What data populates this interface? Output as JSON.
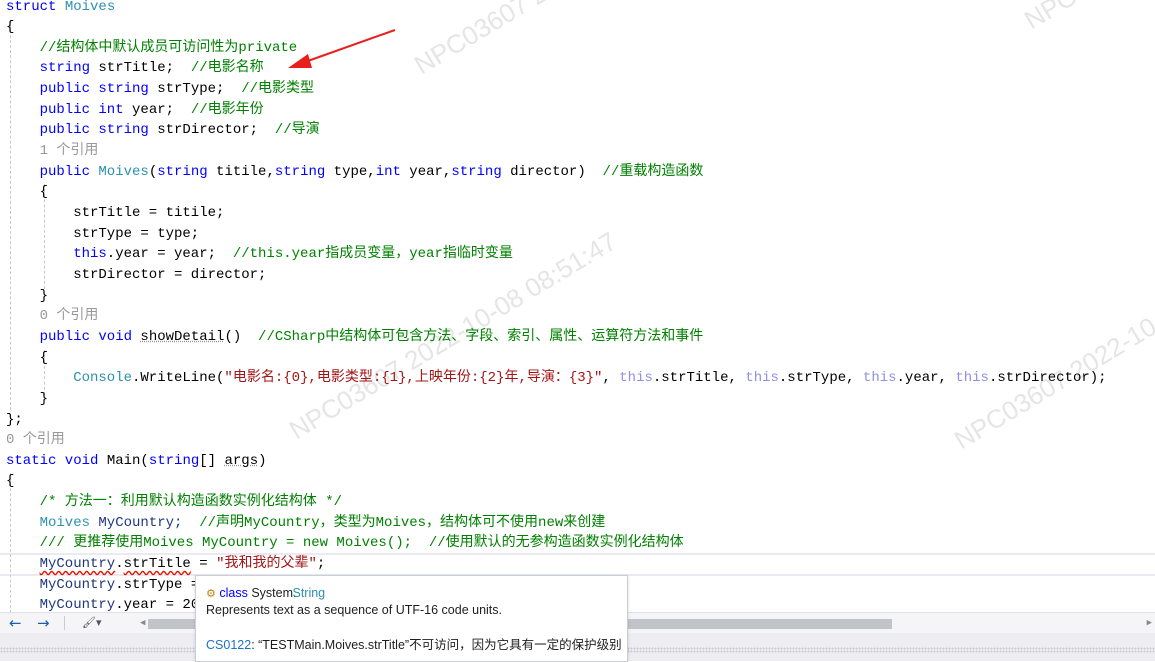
{
  "watermark": "NPC03607 2022-10-08 08:51:47",
  "colors": {
    "keyword": "#0000ff",
    "type": "#2b91af",
    "comment": "#008000",
    "string": "#a31515",
    "annotation_arrow": "#e8201c",
    "error_squiggle": "#e51400"
  },
  "code": [
    {
      "indent": 0,
      "tokens": [
        {
          "t": "struct ",
          "c": "kw"
        },
        {
          "t": "Moives",
          "c": "ty"
        }
      ]
    },
    {
      "indent": 0,
      "tokens": [
        {
          "t": "{",
          "c": "pl"
        }
      ]
    },
    {
      "indent": 4,
      "tokens": [
        {
          "t": "//结构体中默认成员可访问性为private",
          "c": "cm"
        }
      ]
    },
    {
      "indent": 4,
      "tokens": [
        {
          "t": "string ",
          "c": "kw"
        },
        {
          "t": "strTitle;  ",
          "c": "pl"
        },
        {
          "t": "//电影名称",
          "c": "cm"
        }
      ]
    },
    {
      "indent": 4,
      "tokens": [
        {
          "t": "public string ",
          "c": "kw"
        },
        {
          "t": "strType;  ",
          "c": "pl"
        },
        {
          "t": "//电影类型",
          "c": "cm"
        }
      ]
    },
    {
      "indent": 4,
      "tokens": [
        {
          "t": "public int ",
          "c": "kw"
        },
        {
          "t": "year;  ",
          "c": "pl"
        },
        {
          "t": "//电影年份",
          "c": "cm"
        }
      ]
    },
    {
      "indent": 4,
      "tokens": [
        {
          "t": "public string ",
          "c": "kw"
        },
        {
          "t": "strDirector;  ",
          "c": "pl"
        },
        {
          "t": "//导演",
          "c": "cm"
        }
      ]
    },
    {
      "indent": 4,
      "tokens": [
        {
          "t": "1 个引用",
          "c": "ref"
        }
      ]
    },
    {
      "indent": 4,
      "tokens": [
        {
          "t": "public ",
          "c": "kw"
        },
        {
          "t": "Moives",
          "c": "ty"
        },
        {
          "t": "(",
          "c": "pl"
        },
        {
          "t": "string ",
          "c": "kw"
        },
        {
          "t": "titile,",
          "c": "pl"
        },
        {
          "t": "string ",
          "c": "kw"
        },
        {
          "t": "type,",
          "c": "pl"
        },
        {
          "t": "int ",
          "c": "kw"
        },
        {
          "t": "year,",
          "c": "pl"
        },
        {
          "t": "string ",
          "c": "kw"
        },
        {
          "t": "director)  ",
          "c": "pl"
        },
        {
          "t": "//重载构造函数",
          "c": "cm"
        }
      ]
    },
    {
      "indent": 4,
      "tokens": [
        {
          "t": "{",
          "c": "pl"
        }
      ]
    },
    {
      "indent": 8,
      "tokens": [
        {
          "t": "strTitle = titile;",
          "c": "pl"
        }
      ]
    },
    {
      "indent": 8,
      "tokens": [
        {
          "t": "strType = type;",
          "c": "pl"
        }
      ]
    },
    {
      "indent": 8,
      "tokens": [
        {
          "t": "this",
          "c": "kw"
        },
        {
          "t": ".year = year;  ",
          "c": "pl"
        },
        {
          "t": "//this.year指成员变量，year指临时变量",
          "c": "cm"
        }
      ]
    },
    {
      "indent": 8,
      "tokens": [
        {
          "t": "strDirector = director;",
          "c": "pl"
        }
      ]
    },
    {
      "indent": 4,
      "tokens": [
        {
          "t": "}",
          "c": "pl"
        }
      ]
    },
    {
      "indent": 4,
      "tokens": [
        {
          "t": "0 个引用",
          "c": "ref"
        }
      ]
    },
    {
      "indent": 4,
      "tokens": [
        {
          "t": "public void ",
          "c": "kw"
        },
        {
          "t": "showDetail",
          "c": "mt"
        },
        {
          "t": "()  ",
          "c": "pl"
        },
        {
          "t": "//CSharp中结构体可包含方法、字段、索引、属性、运算符方法和事件",
          "c": "cm"
        }
      ]
    },
    {
      "indent": 4,
      "tokens": [
        {
          "t": "{",
          "c": "pl"
        }
      ]
    },
    {
      "indent": 8,
      "tokens": [
        {
          "t": "Console",
          "c": "ty"
        },
        {
          "t": ".WriteLine(",
          "c": "pl"
        },
        {
          "t": "\"电影名:{0},电影类型:{1},上映年份:{2}年,导演：{3}\"",
          "c": "st"
        },
        {
          "t": ", ",
          "c": "pl"
        },
        {
          "t": "this",
          "c": "th"
        },
        {
          "t": ".strTitle, ",
          "c": "pl"
        },
        {
          "t": "this",
          "c": "th"
        },
        {
          "t": ".strType, ",
          "c": "pl"
        },
        {
          "t": "this",
          "c": "th"
        },
        {
          "t": ".year, ",
          "c": "pl"
        },
        {
          "t": "this",
          "c": "th"
        },
        {
          "t": ".strDirector);",
          "c": "pl"
        }
      ]
    },
    {
      "indent": 4,
      "tokens": [
        {
          "t": "}",
          "c": "pl"
        }
      ]
    },
    {
      "indent": 0,
      "tokens": [
        {
          "t": "};",
          "c": "pl"
        }
      ]
    },
    {
      "indent": 0,
      "tokens": [
        {
          "t": "0 个引用",
          "c": "ref"
        }
      ]
    },
    {
      "indent": 0,
      "tokens": [
        {
          "t": "static void ",
          "c": "kw"
        },
        {
          "t": "Main(",
          "c": "pl"
        },
        {
          "t": "string",
          "c": "kw"
        },
        {
          "t": "[] ",
          "c": "pl"
        },
        {
          "t": "args",
          "c": "mt"
        },
        {
          "t": ")",
          "c": "pl"
        }
      ]
    },
    {
      "indent": 0,
      "tokens": [
        {
          "t": "{",
          "c": "pl"
        }
      ]
    },
    {
      "indent": 4,
      "tokens": [
        {
          "t": "/* 方法一：利用默认构造函数实例化结构体 */",
          "c": "cm"
        }
      ]
    },
    {
      "indent": 4,
      "tokens": [
        {
          "t": "Moives ",
          "c": "ty"
        },
        {
          "t": "MyCountry;  ",
          "c": "va"
        },
        {
          "t": "//声明MyCountry，类型为Moives，结构体可不使用new来创建",
          "c": "cm"
        }
      ]
    },
    {
      "indent": 4,
      "tokens": [
        {
          "t": "/// 更推荐使用Moives MyCountry = new Moives();  //使用默认的无参构造函数实例化结构体",
          "c": "cm"
        }
      ]
    },
    {
      "indent": 4,
      "tokens": [
        {
          "t": "MyCountry",
          "c": "va err"
        },
        {
          "t": ".",
          "c": "pl"
        },
        {
          "t": "strTitle",
          "c": "pl err"
        },
        {
          "t": " = ",
          "c": "pl"
        },
        {
          "t": "\"我和我的父辈\"",
          "c": "st"
        },
        {
          "t": ";",
          "c": "pl"
        }
      ]
    },
    {
      "indent": 4,
      "tokens": [
        {
          "t": "MyCountry",
          "c": "va"
        },
        {
          "t": ".strType = ",
          "c": "pl"
        }
      ]
    },
    {
      "indent": 4,
      "tokens": [
        {
          "t": "MyCountry",
          "c": "va"
        },
        {
          "t": ".year = 20",
          "c": "pl"
        }
      ]
    }
  ],
  "toolbar": {
    "back_icon": "←",
    "forward_icon": "→",
    "brush_icon": "🖌▾"
  },
  "tooltip": {
    "kind": "class",
    "ns": "System.",
    "type": "String",
    "description": "Represents text as a sequence of UTF-16 code units.",
    "error_code": "CS0122",
    "error_message": ": “TESTMain.Moives.strTitle”不可访问，因为它具有一定的保护级别"
  }
}
